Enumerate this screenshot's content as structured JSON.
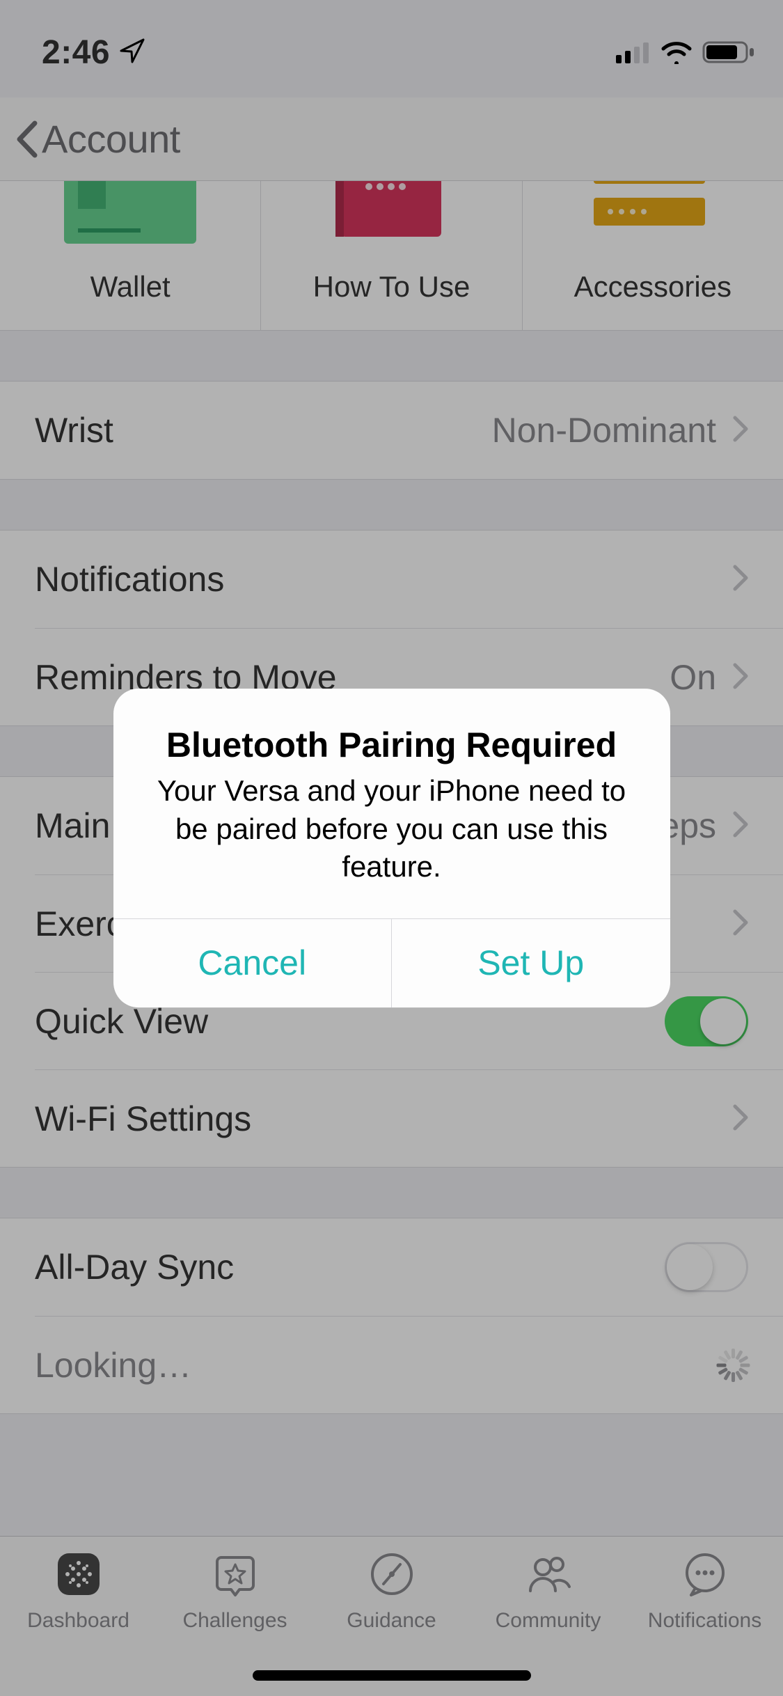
{
  "status_bar": {
    "time": "2:46"
  },
  "nav": {
    "title": "Account"
  },
  "tiles": [
    {
      "label": "Wallet"
    },
    {
      "label": "How To Use"
    },
    {
      "label": "Accessories"
    }
  ],
  "settings": {
    "wrist": {
      "label": "Wrist",
      "value": "Non-Dominant"
    },
    "notifications": {
      "label": "Notifications"
    },
    "reminders": {
      "label": "Reminders to Move",
      "value": "On"
    },
    "main_goal": {
      "label": "Main Goal",
      "value": "Steps"
    },
    "exercise_shortcuts": {
      "label": "Exercise Shortcuts"
    },
    "quick_view": {
      "label": "Quick View",
      "on": true
    },
    "wifi": {
      "label": "Wi-Fi Settings"
    },
    "all_day_sync": {
      "label": "All-Day Sync",
      "on": false
    },
    "sync_status": {
      "label": "Looking…"
    }
  },
  "tab_bar": [
    {
      "label": "Dashboard"
    },
    {
      "label": "Challenges"
    },
    {
      "label": "Guidance"
    },
    {
      "label": "Community"
    },
    {
      "label": "Notifications"
    }
  ],
  "alert": {
    "title": "Bluetooth Pairing Required",
    "message": "Your Versa and your iPhone need to be paired before you can use this feature.",
    "cancel": "Cancel",
    "confirm": "Set Up"
  }
}
